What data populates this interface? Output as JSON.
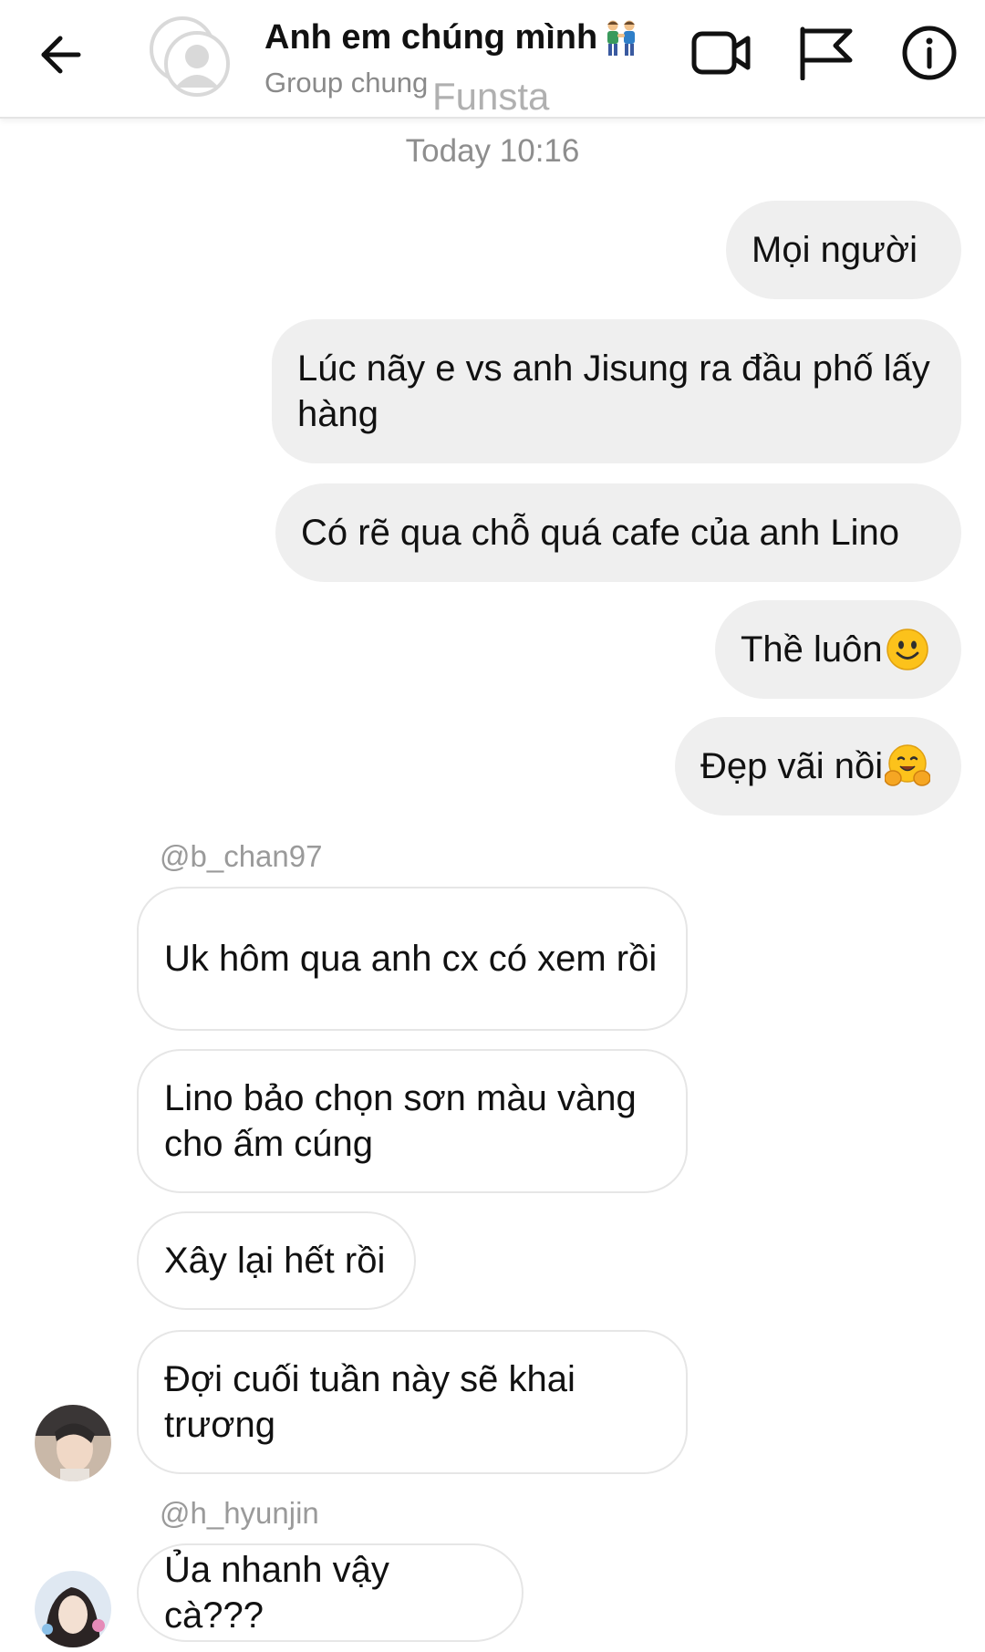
{
  "header": {
    "title": "Anh em chúng mình",
    "subtitle": "Group chung",
    "watermark": "Funsta",
    "icons": [
      "arrow-left-icon",
      "video-camera-icon",
      "flag-icon",
      "info-icon"
    ]
  },
  "timestamp": "Today 10:16",
  "sent_messages": [
    "Mọi người",
    "Lúc nãy e vs anh Jisung ra đầu phố lấy hàng",
    "Có rẽ qua chỗ quá cafe của anh Lino",
    "Thề luôn",
    "Đẹp vãi nồi"
  ],
  "group1": {
    "username": "@b_chan97",
    "messages": [
      "Uk hôm qua anh cx có xem rồi",
      "Lino bảo chọn sơn màu vàng cho ấm cúng",
      "Xây lại hết rồi",
      "Đợi cuối tuần này sẽ khai trương"
    ]
  },
  "group2": {
    "username": "@h_hyunjin",
    "messages": [
      "Ủa nhanh vậy cà???"
    ]
  },
  "colors": {
    "sent_bubble": "#efefef",
    "received_border": "#e6e6e6",
    "muted_text": "#8e8e8e"
  }
}
